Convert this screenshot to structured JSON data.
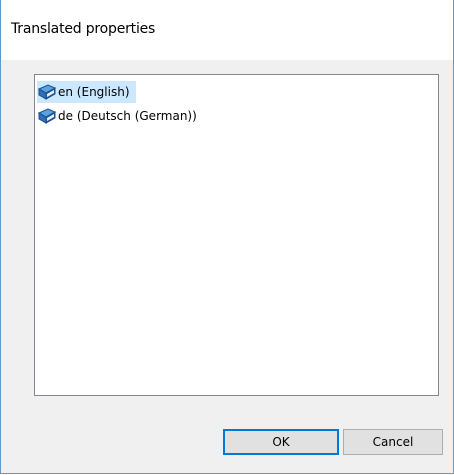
{
  "window": {
    "title": "Translated properties"
  },
  "languages": [
    {
      "label": "en (English)",
      "icon": "book-icon",
      "selected": true
    },
    {
      "label": "de (Deutsch (German))",
      "icon": "book-icon",
      "selected": false
    }
  ],
  "buttons": {
    "ok_label": "OK",
    "cancel_label": "Cancel"
  },
  "colors": {
    "selection_highlight": "#cce8ff",
    "default_button_border": "#0078d7",
    "window_border": "#5b9bd5",
    "dialog_background": "#f0f0f0"
  }
}
